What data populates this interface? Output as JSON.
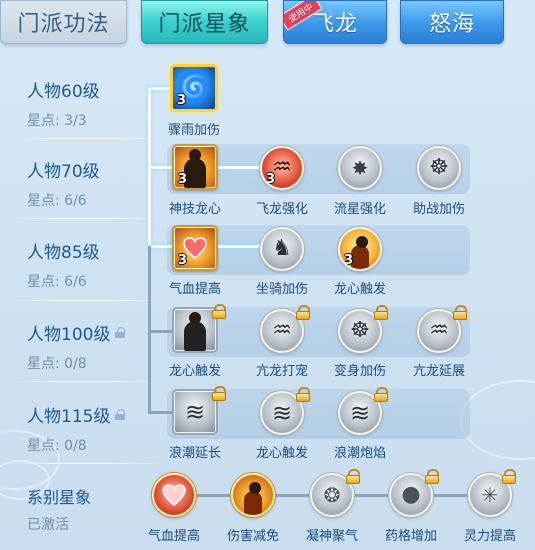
{
  "tabs": [
    {
      "label": "门派功法"
    },
    {
      "label": "门派星象"
    },
    {
      "label": "飞龙",
      "ribbon": "使用中"
    },
    {
      "label": "怒海"
    }
  ],
  "rows": [
    {
      "level": "人物60级",
      "points": "星点: 3/3"
    },
    {
      "level": "人物70级",
      "points": "星点: 6/6"
    },
    {
      "level": "人物85级",
      "points": "星点: 6/6"
    },
    {
      "level": "人物100级",
      "points": "星点: 0/8"
    },
    {
      "level": "人物115级",
      "points": "星点: 0/8"
    }
  ],
  "skills": {
    "r1": [
      {
        "name": "骤雨加伤",
        "count": "3",
        "icon": "water-vortex-icon"
      }
    ],
    "r2": [
      {
        "name": "神技龙心",
        "count": "3",
        "icon": "fire-warrior-icon"
      },
      {
        "name": "飞龙强化",
        "count": "3",
        "icon": "red-dragon-icon"
      },
      {
        "name": "流星强化",
        "count": "",
        "icon": "meteor-icon"
      },
      {
        "name": "助战加伤",
        "count": "",
        "icon": "meditation-icon"
      }
    ],
    "r3": [
      {
        "name": "气血提高",
        "count": "3",
        "icon": "heart-icon"
      },
      {
        "name": "坐骑加伤",
        "count": "",
        "icon": "beast-mount-icon"
      },
      {
        "name": "龙心触发",
        "count": "3",
        "icon": "fire-warrior-icon"
      }
    ],
    "r4": [
      {
        "name": "龙心触发",
        "count": "",
        "icon": "warrior-icon"
      },
      {
        "name": "亢龙打宠",
        "count": "",
        "icon": "dragon-icon"
      },
      {
        "name": "变身加伤",
        "count": "",
        "icon": "meditation-icon"
      },
      {
        "name": "亢龙延展",
        "count": "",
        "icon": "dragon-icon"
      }
    ],
    "r5": [
      {
        "name": "浪潮延长",
        "count": "",
        "icon": "wave-icon"
      },
      {
        "name": "龙心触发",
        "count": "",
        "icon": "wave-icon"
      },
      {
        "name": "浪潮炮焰",
        "count": "",
        "icon": "wave-icon"
      }
    ]
  },
  "series": {
    "title": "系别星象",
    "status": "已激活",
    "items": [
      {
        "name": "气血提高",
        "icon": "heart-icon"
      },
      {
        "name": "伤害减免",
        "icon": "shield-warrior-icon"
      },
      {
        "name": "凝神聚气",
        "icon": "spark-icon"
      },
      {
        "name": "药格增加",
        "icon": "orb-icon"
      },
      {
        "name": "灵力提高",
        "icon": "sparkle-icon"
      }
    ]
  },
  "colors": {
    "accent_tab": "#3fd3cf",
    "blue_tab": "#3c97e8",
    "label_text": "#1f5a8a",
    "points_text": "#7390aa"
  }
}
